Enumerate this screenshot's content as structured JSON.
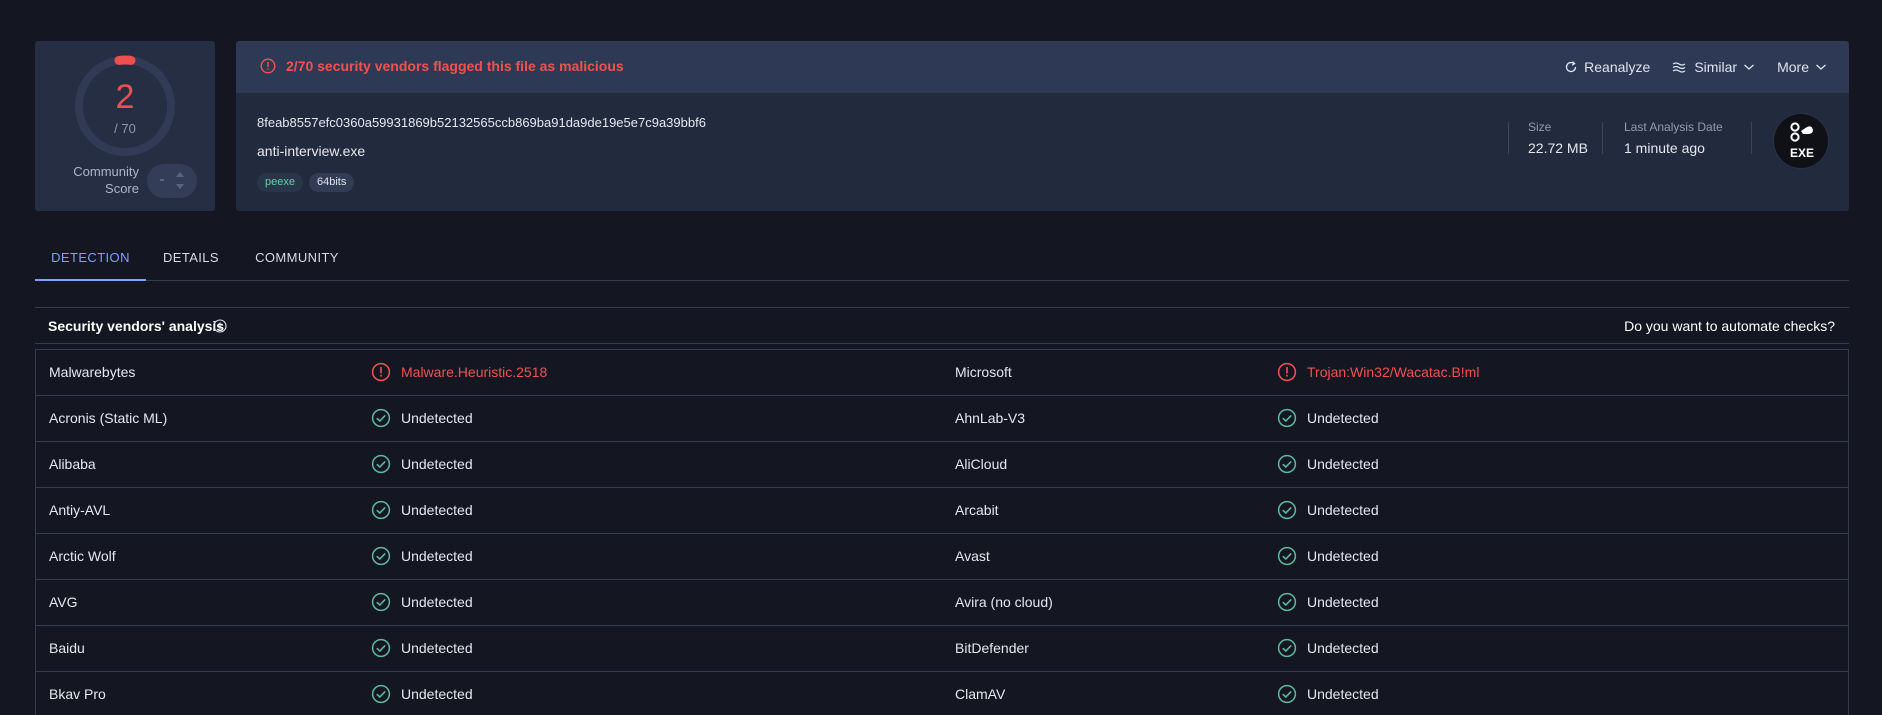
{
  "score": {
    "detections": "2",
    "total": "/ 70",
    "community_label_1": "Community",
    "community_label_2": "Score"
  },
  "alert": {
    "text": "2/70 security vendors flagged this file as malicious"
  },
  "actions": {
    "reanalyze": "Reanalyze",
    "similar": "Similar",
    "more": "More"
  },
  "file": {
    "hash": "8feab8557efc0360a59931869b52132565ccb869ba91da9de19e5e7c9a39bbf6",
    "name": "anti-interview.exe",
    "tags": [
      "peexe",
      "64bits"
    ],
    "size_label": "Size",
    "size_value": "22.72 MB",
    "date_label": "Last Analysis Date",
    "date_value": "1 minute ago",
    "type_badge": "EXE"
  },
  "tabs": [
    "DETECTION",
    "DETAILS",
    "COMMUNITY"
  ],
  "section": {
    "title": "Security vendors' analysis",
    "automate": "Do you want to automate checks?"
  },
  "colors": {
    "detected": "#f35151",
    "clean": "#5fb8a0",
    "accent": "#7ea1ff"
  },
  "vendors": [
    [
      {
        "name": "Malwarebytes",
        "result": "Malware.Heuristic.2518",
        "status": "detected"
      },
      {
        "name": "Microsoft",
        "result": "Trojan:Win32/Wacatac.B!ml",
        "status": "detected"
      }
    ],
    [
      {
        "name": "Acronis (Static ML)",
        "result": "Undetected",
        "status": "clean"
      },
      {
        "name": "AhnLab-V3",
        "result": "Undetected",
        "status": "clean"
      }
    ],
    [
      {
        "name": "Alibaba",
        "result": "Undetected",
        "status": "clean"
      },
      {
        "name": "AliCloud",
        "result": "Undetected",
        "status": "clean"
      }
    ],
    [
      {
        "name": "Antiy-AVL",
        "result": "Undetected",
        "status": "clean"
      },
      {
        "name": "Arcabit",
        "result": "Undetected",
        "status": "clean"
      }
    ],
    [
      {
        "name": "Arctic Wolf",
        "result": "Undetected",
        "status": "clean"
      },
      {
        "name": "Avast",
        "result": "Undetected",
        "status": "clean"
      }
    ],
    [
      {
        "name": "AVG",
        "result": "Undetected",
        "status": "clean"
      },
      {
        "name": "Avira (no cloud)",
        "result": "Undetected",
        "status": "clean"
      }
    ],
    [
      {
        "name": "Baidu",
        "result": "Undetected",
        "status": "clean"
      },
      {
        "name": "BitDefender",
        "result": "Undetected",
        "status": "clean"
      }
    ],
    [
      {
        "name": "Bkav Pro",
        "result": "Undetected",
        "status": "clean"
      },
      {
        "name": "ClamAV",
        "result": "Undetected",
        "status": "clean"
      }
    ]
  ]
}
